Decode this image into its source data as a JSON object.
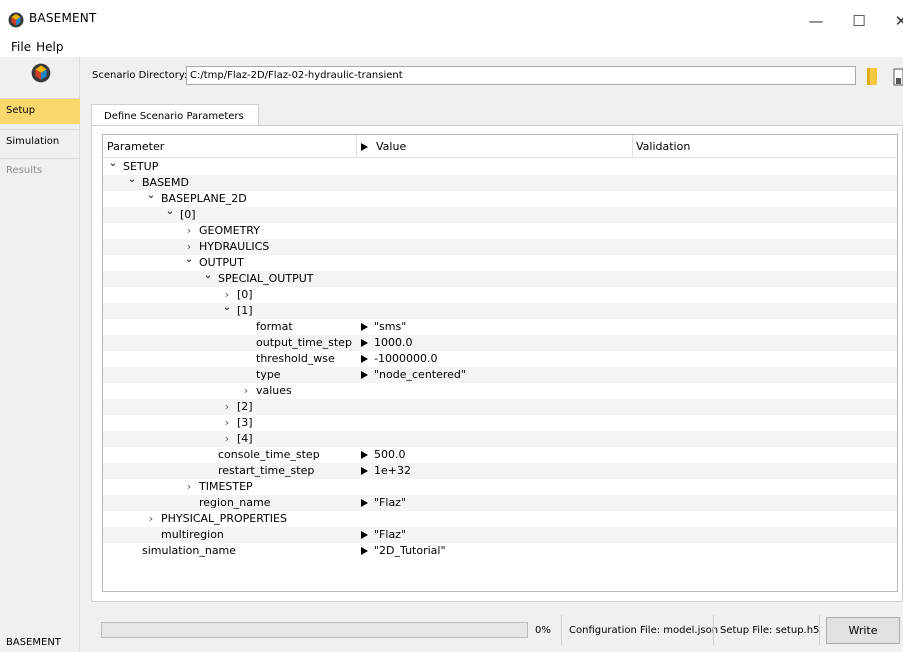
{
  "window": {
    "title": "BASEMENT",
    "minimize_glyph": "—",
    "maximize_glyph": "☐",
    "close_glyph": "✕"
  },
  "menu": [
    "File",
    "Help"
  ],
  "sidebar": {
    "items": [
      {
        "label": "Setup",
        "state": "selected"
      },
      {
        "label": "Simulation",
        "state": "normal"
      },
      {
        "label": "Results",
        "state": "disabled"
      }
    ],
    "footer": "BASEMENT"
  },
  "scenario": {
    "label": "Scenario Directory:",
    "path": "C:/tmp/Flaz-2D/Flaz-02-hydraulic-transient"
  },
  "tab": {
    "label": "Define Scenario Parameters"
  },
  "tree": {
    "columns": [
      "Parameter",
      "Value",
      "Validation"
    ],
    "rows": [
      {
        "indent": 0,
        "toggle": "expanded",
        "label": "SETUP",
        "value": ""
      },
      {
        "indent": 1,
        "toggle": "expanded",
        "label": "BASEMD",
        "value": ""
      },
      {
        "indent": 2,
        "toggle": "expanded",
        "label": "BASEPLANE_2D",
        "value": ""
      },
      {
        "indent": 3,
        "toggle": "expanded",
        "label": "[0]",
        "value": ""
      },
      {
        "indent": 4,
        "toggle": "collapsed",
        "label": "GEOMETRY",
        "value": ""
      },
      {
        "indent": 4,
        "toggle": "collapsed",
        "label": "HYDRAULICS",
        "value": ""
      },
      {
        "indent": 4,
        "toggle": "expanded",
        "label": "OUTPUT",
        "value": ""
      },
      {
        "indent": 5,
        "toggle": "expanded",
        "label": "SPECIAL_OUTPUT",
        "value": ""
      },
      {
        "indent": 6,
        "toggle": "collapsed",
        "label": "[0]",
        "value": ""
      },
      {
        "indent": 6,
        "toggle": "expanded",
        "label": "[1]",
        "value": ""
      },
      {
        "indent": 7,
        "toggle": "none",
        "label": "format",
        "value": "\"sms\""
      },
      {
        "indent": 7,
        "toggle": "none",
        "label": "output_time_step",
        "value": "1000.0"
      },
      {
        "indent": 7,
        "toggle": "none",
        "label": "threshold_wse",
        "value": "-1000000.0"
      },
      {
        "indent": 7,
        "toggle": "none",
        "label": "type",
        "value": "\"node_centered\""
      },
      {
        "indent": 7,
        "toggle": "collapsed",
        "label": "values",
        "value": ""
      },
      {
        "indent": 6,
        "toggle": "collapsed",
        "label": "[2]",
        "value": ""
      },
      {
        "indent": 6,
        "toggle": "collapsed",
        "label": "[3]",
        "value": ""
      },
      {
        "indent": 6,
        "toggle": "collapsed",
        "label": "[4]",
        "value": ""
      },
      {
        "indent": 5,
        "toggle": "none",
        "label": "console_time_step",
        "value": "500.0"
      },
      {
        "indent": 5,
        "toggle": "none",
        "label": "restart_time_step",
        "value": "1e+32"
      },
      {
        "indent": 4,
        "toggle": "collapsed",
        "label": "TIMESTEP",
        "value": ""
      },
      {
        "indent": 4,
        "toggle": "none",
        "label": "region_name",
        "value": "\"Flaz\""
      },
      {
        "indent": 2,
        "toggle": "collapsed",
        "label": "PHYSICAL_PROPERTIES",
        "value": ""
      },
      {
        "indent": 2,
        "toggle": "none",
        "label": "multiregion",
        "value": "\"Flaz\""
      },
      {
        "indent": 1,
        "toggle": "none",
        "label": "simulation_name",
        "value": "\"2D_Tutorial\""
      }
    ]
  },
  "footer": {
    "progress_percent": 0,
    "progress_label": "0%",
    "config_file": "Configuration File: model.json",
    "setup_file": "Setup File: setup.h5",
    "write_label": "Write"
  },
  "colors": {
    "selected_sidebar": "#fbd86e",
    "panel_background": "#f0f0f0",
    "folder_icon": "#f5c842"
  }
}
